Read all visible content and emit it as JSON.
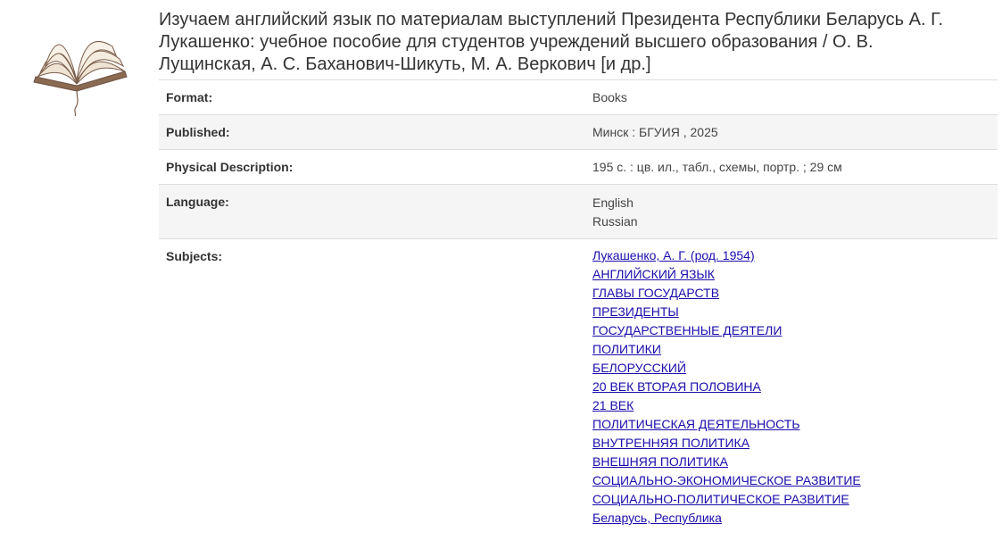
{
  "record": {
    "icon": "open-book-icon",
    "title_lines": [
      "Изучаем английский язык по материалам выступлений Президента Республики Беларусь А. Г.",
      "Лукашенко: учебное пособие для студентов учреждений высшего образования / О. В.",
      "Лущинская, А. С. Баханович-Шикуть, М. А. Веркович [и др.]"
    ],
    "details": {
      "format": {
        "label": "Format:",
        "value": "Books"
      },
      "published": {
        "label": "Published:",
        "value": "Минск : БГУИЯ , 2025"
      },
      "physical": {
        "label": "Physical Description:",
        "value": "195 с. : цв. ил., табл., схемы, портр. ; 29 см"
      },
      "language": {
        "label": "Language:",
        "values": [
          "English",
          "Russian"
        ]
      },
      "subjects": {
        "label": "Subjects:",
        "items": [
          "Лукашенко, А. Г. (род. 1954)",
          "АНГЛИЙСКИЙ ЯЗЫК",
          "ГЛАВЫ ГОСУДАРСТВ",
          "ПРЕЗИДЕНТЫ",
          "ГОСУДАРСТВЕННЫЕ ДЕЯТЕЛИ",
          "ПОЛИТИКИ",
          "БЕЛОРУССКИЙ",
          "20 ВЕК ВТОРАЯ ПОЛОВИНА",
          "21 ВЕК",
          "ПОЛИТИЧЕСКАЯ ДЕЯТЕЛЬНОСТЬ",
          "ВНУТРЕННЯЯ ПОЛИТИКА",
          "ВНЕШНЯЯ ПОЛИТИКА",
          "СОЦИАЛЬНО-ЭКОНОМИЧЕСКОЕ РАЗВИТИЕ",
          "СОЦИАЛЬНО-ПОЛИТИЧЕСКОЕ РАЗВИТИЕ",
          "Беларусь, Республика"
        ]
      }
    }
  },
  "colors": {
    "link": "#1a0dab",
    "row_shade": "#f5f5f5",
    "border": "#dddddd"
  }
}
